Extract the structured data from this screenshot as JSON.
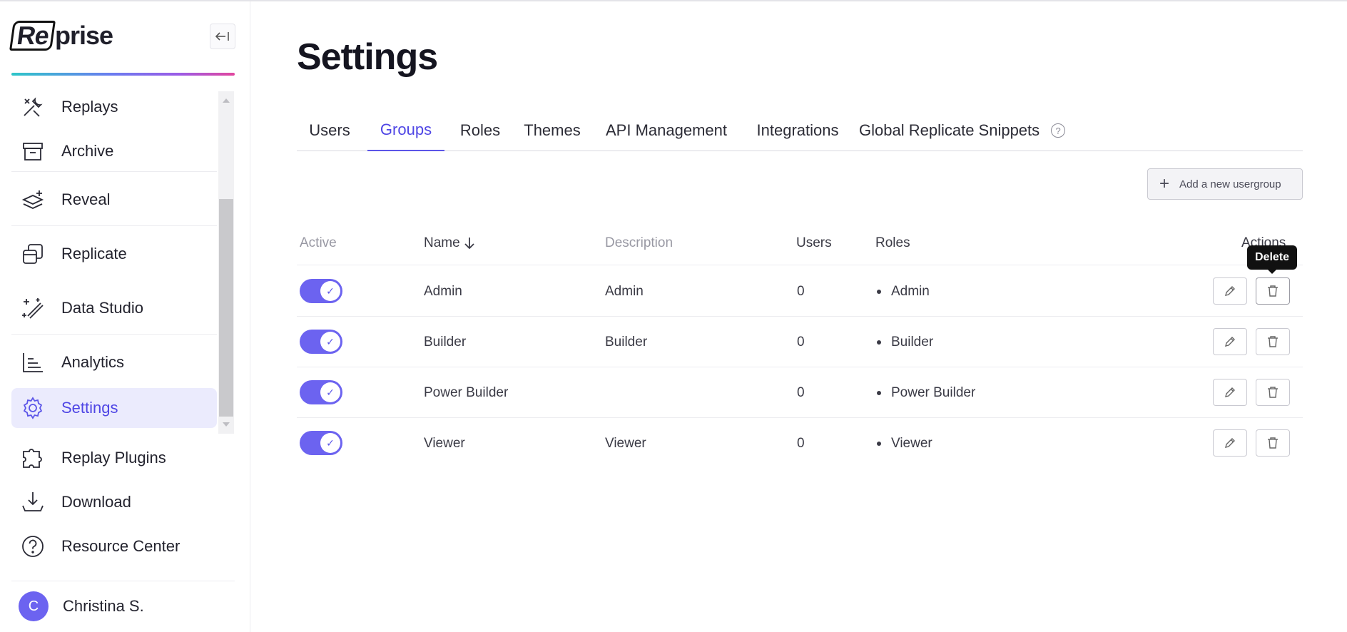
{
  "app": {
    "logo_boxed": "Re",
    "logo_rest": "prise"
  },
  "sidebar": {
    "items": [
      {
        "label": "Replays",
        "icon": "replays-icon"
      },
      {
        "label": "Archive",
        "icon": "archive-icon"
      },
      {
        "label": "Reveal",
        "icon": "reveal-icon"
      },
      {
        "label": "Replicate",
        "icon": "replicate-icon"
      },
      {
        "label": "Data Studio",
        "icon": "data-studio-icon"
      },
      {
        "label": "Analytics",
        "icon": "analytics-icon"
      },
      {
        "label": "Settings",
        "icon": "gear-icon",
        "active": true
      }
    ],
    "bottom_items": [
      {
        "label": "Replay Plugins",
        "icon": "puzzle-icon"
      },
      {
        "label": "Download",
        "icon": "download-icon"
      },
      {
        "label": "Resource Center",
        "icon": "help-circle-icon"
      }
    ],
    "user": {
      "initial": "C",
      "name": "Christina S."
    }
  },
  "page": {
    "title": "Settings",
    "tabs": [
      {
        "label": "Users"
      },
      {
        "label": "Groups",
        "active": true
      },
      {
        "label": "Roles"
      },
      {
        "label": "Themes"
      },
      {
        "label": "API Management"
      },
      {
        "label": "Integrations"
      },
      {
        "label": "Global Replicate Snippets"
      }
    ],
    "add_button_label": "Add a new usergroup",
    "columns": {
      "active": "Active",
      "name": "Name",
      "description": "Description",
      "users": "Users",
      "roles": "Roles",
      "actions": "Actions"
    },
    "rows": [
      {
        "name": "Admin",
        "description": "Admin",
        "users": "0",
        "role": "Admin",
        "active": true
      },
      {
        "name": "Builder",
        "description": "Builder",
        "users": "0",
        "role": "Builder",
        "active": true
      },
      {
        "name": "Power Builder",
        "description": "",
        "users": "0",
        "role": "Power Builder",
        "active": true
      },
      {
        "name": "Viewer",
        "description": "Viewer",
        "users": "0",
        "role": "Viewer",
        "active": true
      }
    ],
    "tooltip": "Delete"
  },
  "colors": {
    "accent": "#5b55e8",
    "toggle_on": "#6c63f0",
    "active_nav_bg": "#ebebfd"
  }
}
